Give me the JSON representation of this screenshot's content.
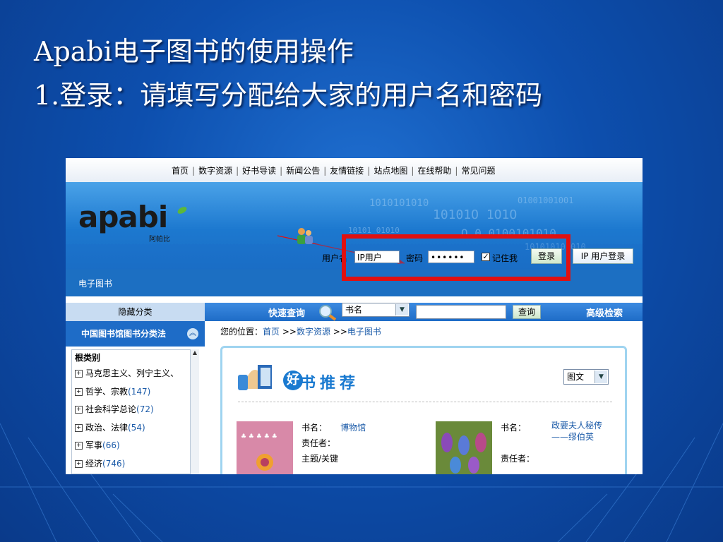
{
  "slide": {
    "title_line1": "Apabi电子图书的使用操作",
    "title_line2": "1.登录：请填写分配给大家的用户名和密码"
  },
  "site": {
    "nav": [
      "首页",
      "数字资源",
      "好书导读",
      "新闻公告",
      "友情链接",
      "站点地图",
      "在线帮助",
      "常见问题"
    ],
    "logo_text": "apabi",
    "logo_sub": "阿帕比",
    "login": {
      "username_label": "用户名",
      "username_value": "IP用户",
      "password_label": "密码",
      "password_value": "••••••",
      "remember_label": "记住我",
      "remember_checked": "✓",
      "login_button": "登录",
      "ip_login_button": "IP 用户登录"
    },
    "section_label": "电子图书",
    "search": {
      "hide_category": "隐藏分类",
      "quick_search": "快速查询",
      "field_select": "书名",
      "query_button": "查询",
      "advanced": "高级检索"
    },
    "sidebar": {
      "heading": "中国图书馆图书分类法",
      "root_label": "根类别",
      "items": [
        {
          "label": "马克思主义、列宁主义、",
          "count": ""
        },
        {
          "label": "哲学、宗教",
          "count": "(147)"
        },
        {
          "label": "社会科学总论",
          "count": "(72)"
        },
        {
          "label": "政治、法律",
          "count": "(54)"
        },
        {
          "label": "军事",
          "count": "(66)"
        },
        {
          "label": "经济",
          "count": "(746)"
        }
      ]
    },
    "breadcrumb": {
      "prefix": "您的位置：",
      "home": "首页",
      "sep": " >>",
      "level2": "数字资源",
      "level3": "电子图书"
    },
    "recommend": {
      "hao": "好",
      "title": "书推荐",
      "view_select": "图文",
      "books": [
        {
          "name_label": "书名：",
          "name_value": "博物馆",
          "author_label": "责任者：",
          "subject_label": "主题/关键"
        },
        {
          "name_label": "书名：",
          "name_value": "政要夫人秘传——缪伯英",
          "author_label": "责任者："
        }
      ]
    }
  },
  "colors": {
    "slide_bg": "#0d4fae",
    "highlight": "#e01010",
    "link": "#1a5aa8"
  }
}
